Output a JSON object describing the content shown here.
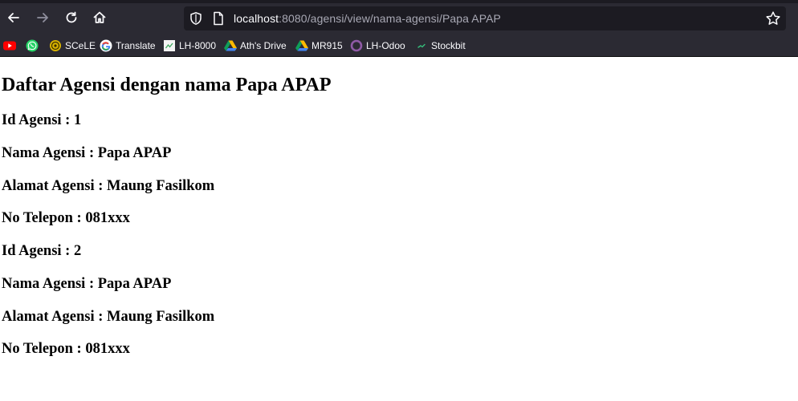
{
  "browser": {
    "url": {
      "host": "localhost",
      "rest": ":8080/agensi/view/nama-agensi/Papa APAP"
    },
    "bookmarks": [
      {
        "label": "",
        "icon": "youtube-icon"
      },
      {
        "label": "",
        "icon": "whatsapp-icon"
      },
      {
        "label": "SCeLE",
        "icon": "scele-icon"
      },
      {
        "label": "Translate",
        "icon": "google-icon"
      },
      {
        "label": "LH-8000",
        "icon": "page-icon"
      },
      {
        "label": "Ath's Drive",
        "icon": "drive-icon"
      },
      {
        "label": "MR915",
        "icon": "drive-icon"
      },
      {
        "label": "LH-Odoo",
        "icon": "odoo-icon"
      },
      {
        "label": "Stockbit",
        "icon": "stockbit-icon"
      }
    ]
  },
  "page": {
    "title": "Daftar Agensi dengan nama Papa APAP",
    "agencies": [
      {
        "id_line": "Id Agensi : 1",
        "name_line": "Nama Agensi : Papa APAP",
        "address_line": "Alamat Agensi : Maung Fasilkom",
        "phone_line": "No Telepon : 081xxx"
      },
      {
        "id_line": "Id Agensi : 2",
        "name_line": "Nama Agensi : Papa APAP",
        "address_line": "Alamat Agensi : Maung Fasilkom",
        "phone_line": "No Telepon : 081xxx"
      }
    ]
  }
}
